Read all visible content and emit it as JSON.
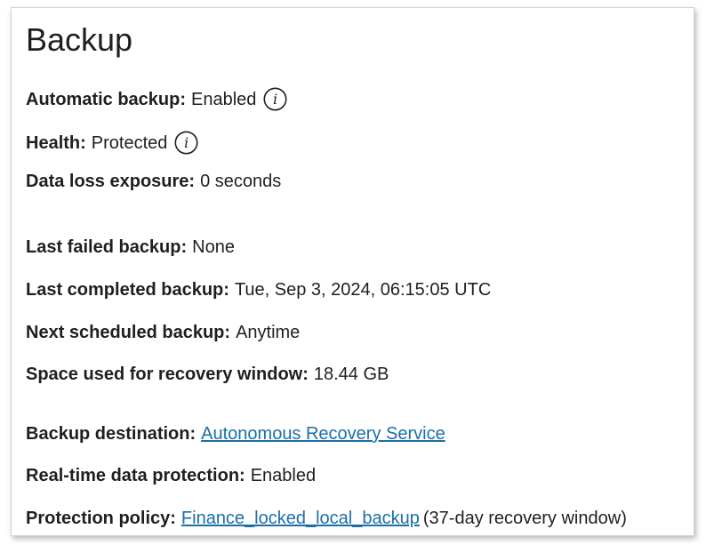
{
  "panel": {
    "title": "Backup"
  },
  "fields": {
    "automatic_backup": {
      "label": "Automatic backup:",
      "value": "Enabled",
      "info_icon": "info-icon"
    },
    "health": {
      "label": "Health:",
      "value": "Protected",
      "info_icon": "info-icon"
    },
    "data_loss_exposure": {
      "label": "Data loss exposure:",
      "value": "0 seconds"
    },
    "last_failed_backup": {
      "label": "Last failed backup:",
      "value": "None"
    },
    "last_completed_backup": {
      "label": "Last completed backup:",
      "value": "Tue, Sep 3, 2024, 06:15:05 UTC"
    },
    "next_scheduled_backup": {
      "label": "Next scheduled backup:",
      "value": "Anytime"
    },
    "space_used": {
      "label": "Space used for recovery window:",
      "value": "18.44 GB"
    },
    "backup_destination": {
      "label": "Backup destination:",
      "link": "Autonomous Recovery Service"
    },
    "real_time_protection": {
      "label": "Real-time data protection:",
      "value": "Enabled"
    },
    "protection_policy": {
      "label": "Protection policy:",
      "link": "Finance_locked_local_backup",
      "suffix": "(37-day recovery window)"
    }
  },
  "colors": {
    "link": "#1a6fa8",
    "text": "#1f1f1f",
    "panel_border": "#d4d4d4"
  }
}
